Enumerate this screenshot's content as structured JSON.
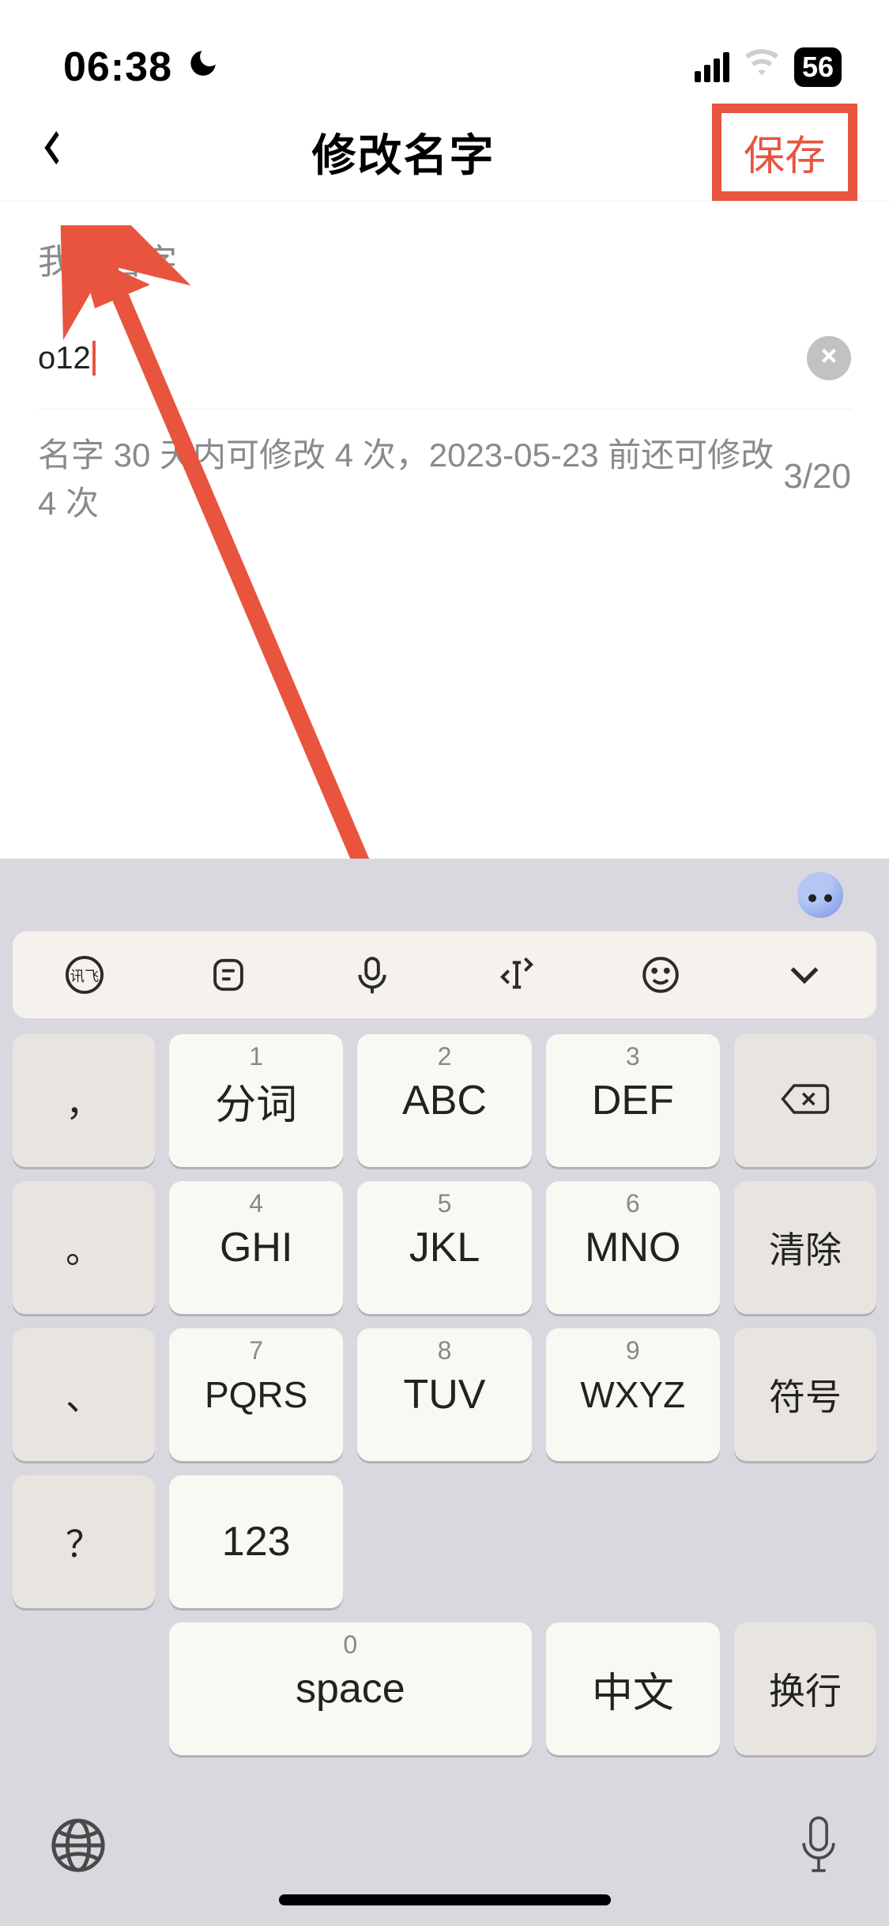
{
  "status": {
    "time": "06:38",
    "battery": "56"
  },
  "nav": {
    "title": "修改名字",
    "save": "保存"
  },
  "form": {
    "label": "我的名字",
    "value": "o12",
    "hint": "名字 30 天内可修改 4 次，2023-05-23 前还可修改 4 次",
    "counter": "3/20"
  },
  "keyboard": {
    "toolbar_brand": "讯飞",
    "rows": [
      {
        "punct": "，",
        "k1": {
          "n": "1",
          "l": "分词"
        },
        "k2": {
          "n": "2",
          "l": "ABC"
        },
        "k3": {
          "n": "3",
          "l": "DEF"
        },
        "act": "backspace"
      },
      {
        "punct": "。",
        "k1": {
          "n": "4",
          "l": "GHI"
        },
        "k2": {
          "n": "5",
          "l": "JKL"
        },
        "k3": {
          "n": "6",
          "l": "MNO"
        },
        "act": "清除"
      },
      {
        "punct": "、",
        "k1": {
          "n": "7",
          "l": "PQRS"
        },
        "k2": {
          "n": "8",
          "l": "TUV"
        },
        "k3": {
          "n": "9",
          "l": "WXYZ"
        },
        "act": "符号"
      },
      {
        "punct": "？",
        "k1": {
          "n": "",
          "l": "123"
        },
        "space": {
          "n": "0",
          "l": "space"
        },
        "k3": {
          "n": "",
          "l": "中文"
        },
        "act": "换行"
      }
    ]
  }
}
